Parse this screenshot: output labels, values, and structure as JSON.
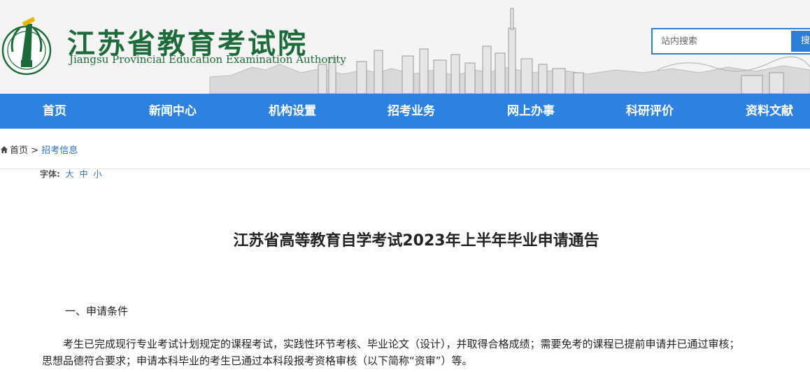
{
  "header": {
    "title_cn": "江苏省教育考试院",
    "title_en": "Jiangsu Provincial Education Examination Authority",
    "brand_color": "#1d6b3a"
  },
  "search": {
    "placeholder": "站内搜索",
    "button_label": "搜"
  },
  "nav": {
    "background": "#2d82e0",
    "items": [
      {
        "label": "首页"
      },
      {
        "label": "新闻中心"
      },
      {
        "label": "机构设置"
      },
      {
        "label": "招考业务"
      },
      {
        "label": "网上办事"
      },
      {
        "label": "科研评价"
      },
      {
        "label": "资料文献"
      }
    ]
  },
  "breadcrumb": {
    "icon": "home-icon",
    "home": "首页",
    "separator": ">",
    "current": "招考信息"
  },
  "font_size": {
    "label": "字体:",
    "options": [
      "大",
      "中",
      "小"
    ]
  },
  "article": {
    "title": "江苏省高等教育自学考试2023年上半年毕业申请通告",
    "section_1_heading": "一、申请条件",
    "section_1_para_line1": "考生已完成现行专业考试计划规定的课程考试，实践性环节考核、毕业论文（设计），并取得合格成绩；需要免考的课程已提前申请并已通过审核；",
    "section_1_para_line2": "思想品德符合要求；申请本科毕业的考生已通过本科段报考资格审核（以下简称“资审”）等。"
  }
}
